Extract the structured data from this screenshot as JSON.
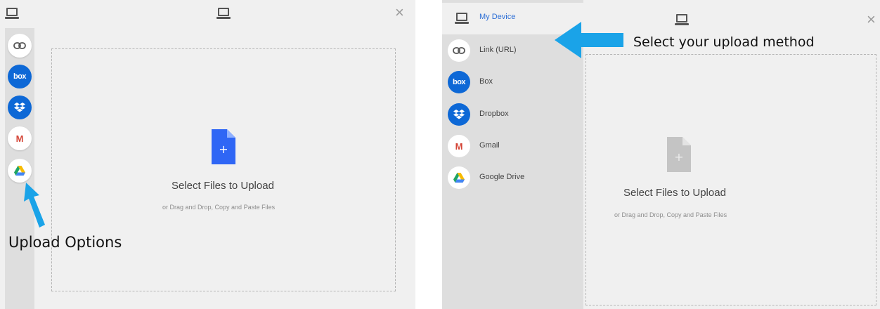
{
  "dropzone": {
    "title": "Select Files to Upload",
    "subtitle": "or Drag and Drop, Copy and Paste Files",
    "plus": "+"
  },
  "close_symbol": "×",
  "left_panel": {
    "annotation": "Upload Options",
    "rail": [
      {
        "icon": "link-icon"
      },
      {
        "icon": "box-icon",
        "text": "box"
      },
      {
        "icon": "dropbox-icon"
      },
      {
        "icon": "gmail-icon",
        "text": "M"
      },
      {
        "icon": "google-drive-icon"
      }
    ]
  },
  "right_panel": {
    "annotation": "Select your upload method",
    "sources": [
      {
        "label": "My Device",
        "icon": "laptop-icon",
        "active": true
      },
      {
        "label": "Link (URL)",
        "icon": "link-icon"
      },
      {
        "label": "Box",
        "icon": "box-icon",
        "text": "box"
      },
      {
        "label": "Dropbox",
        "icon": "dropbox-icon"
      },
      {
        "label": "Gmail",
        "icon": "gmail-icon",
        "text": "M"
      },
      {
        "label": "Google Drive",
        "icon": "google-drive-icon"
      }
    ]
  },
  "colors": {
    "accent_blue": "#2f66f5",
    "box_blue": "#0d68d6",
    "arrow_blue": "#1aa3e8",
    "gmail_red": "#d44638"
  }
}
